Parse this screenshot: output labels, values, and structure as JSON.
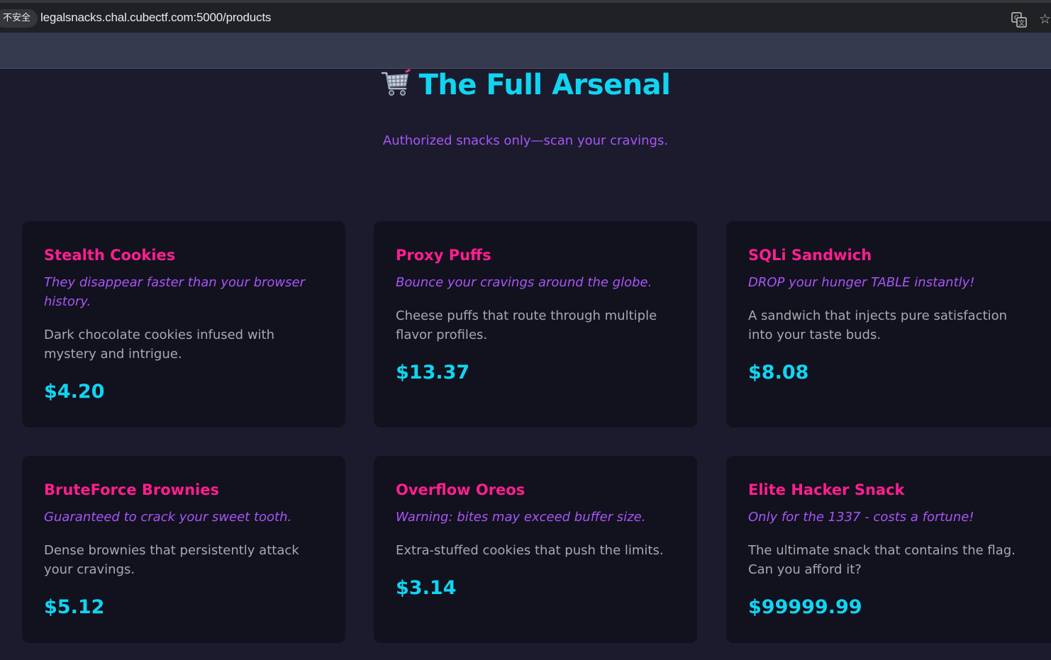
{
  "browser": {
    "security_label": "不安全",
    "url": "legalsnacks.chal.cubectf.com:5000/products"
  },
  "header": {
    "icon": "shopping-cart-icon",
    "title": "The Full Arsenal",
    "subtitle": "Authorized snacks only—scan your cravings."
  },
  "products": [
    {
      "name": "Stealth Cookies",
      "tagline": "They disappear faster than your browser history.",
      "description": "Dark chocolate cookies infused with mystery and intrigue.",
      "price": "$4.20"
    },
    {
      "name": "Proxy Puffs",
      "tagline": "Bounce your cravings around the globe.",
      "description": "Cheese puffs that route through multiple flavor profiles.",
      "price": "$13.37"
    },
    {
      "name": "SQLi Sandwich",
      "tagline": "DROP your hunger TABLE instantly!",
      "description": "A sandwich that injects pure satisfaction into your taste buds.",
      "price": "$8.08"
    },
    {
      "name": "BruteForce Brownies",
      "tagline": "Guaranteed to crack your sweet tooth.",
      "description": "Dense brownies that persistently attack your cravings.",
      "price": "$5.12"
    },
    {
      "name": "Overflow Oreos",
      "tagline": "Warning: bites may exceed buffer size.",
      "description": "Extra-stuffed cookies that push the limits.",
      "price": "$3.14"
    },
    {
      "name": "Elite Hacker Snack",
      "tagline": "Only for the 1337 - costs a fortune!",
      "description": "The ultimate snack that contains the flag. Can you afford it?",
      "price": "$99999.99"
    }
  ],
  "colors": {
    "background": "#1b1b2d",
    "card": "#12111e",
    "accent_cyan": "#10d5f2",
    "accent_pink": "#ff1f8e",
    "accent_purple": "#a855f7"
  }
}
